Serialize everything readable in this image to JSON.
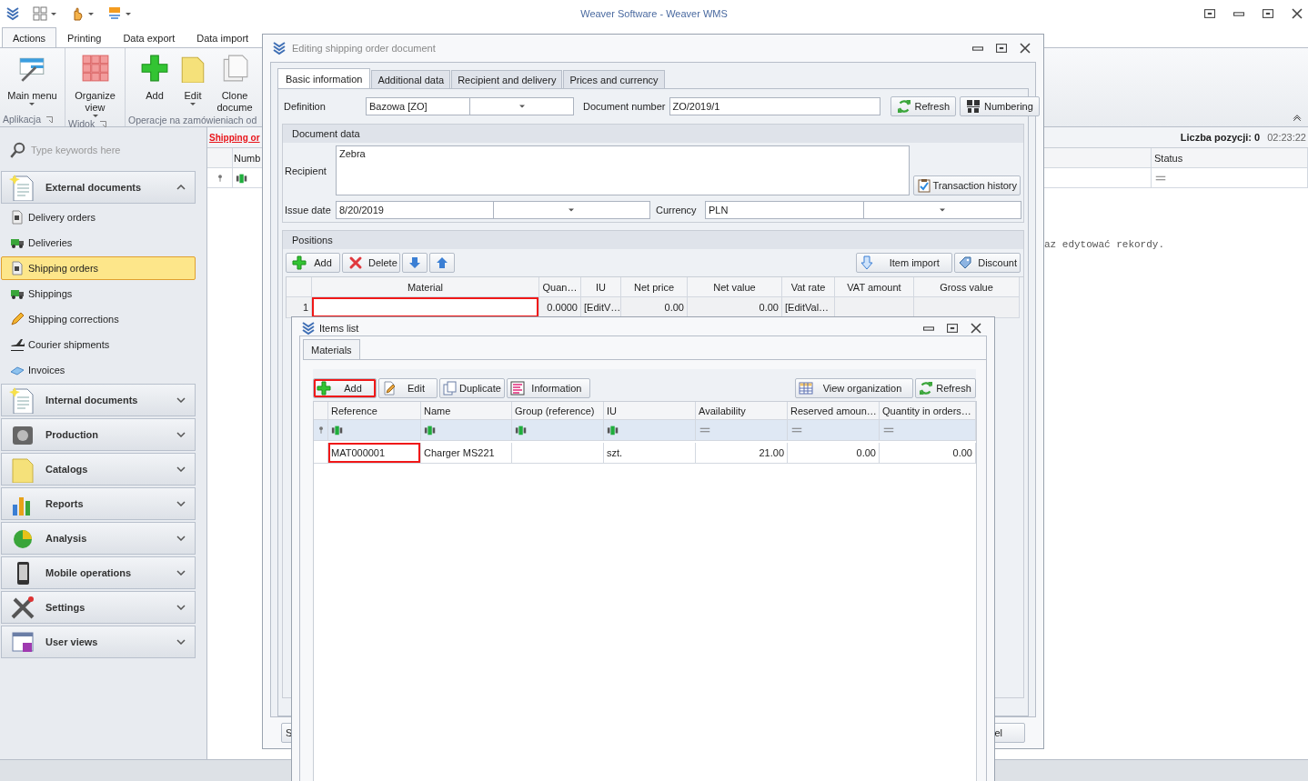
{
  "window": {
    "title": "Weaver Software - Weaver WMS"
  },
  "ribbon": {
    "tabs": [
      {
        "label": "Actions",
        "selected": true
      },
      {
        "label": "Printing",
        "selected": false
      },
      {
        "label": "Data export",
        "selected": false
      },
      {
        "label": "Data import",
        "selected": false
      }
    ],
    "groups": [
      {
        "label": "Aplikacja",
        "launcher": true,
        "items": [
          {
            "label": "Main menu",
            "dropdown": true
          }
        ]
      },
      {
        "label": "Widok",
        "launcher": true,
        "items": [
          {
            "label": "Organize view",
            "dropdown": true
          }
        ]
      },
      {
        "label": "Operacje na zamówieniach od",
        "launcher": false,
        "items": [
          {
            "label": "Add",
            "dropdown": false
          },
          {
            "label": "Edit",
            "dropdown": true
          },
          {
            "label": "Clone docume",
            "dropdown": false
          }
        ]
      }
    ]
  },
  "sidebar": {
    "search": {
      "placeholder": "Type keywords here"
    },
    "groups": [
      {
        "label": "External documents",
        "expanded": true,
        "items": [
          {
            "label": "Delivery orders",
            "selected": false
          },
          {
            "label": "Deliveries",
            "selected": false
          },
          {
            "label": "Shipping orders",
            "selected": true
          },
          {
            "label": "Shippings",
            "selected": false
          },
          {
            "label": "Shipping corrections",
            "selected": false
          },
          {
            "label": "Courier shipments",
            "selected": false
          },
          {
            "label": "Invoices",
            "selected": false
          }
        ]
      },
      {
        "label": "Internal documents",
        "expanded": false
      },
      {
        "label": "Production",
        "expanded": false
      },
      {
        "label": "Catalogs",
        "expanded": false
      },
      {
        "label": "Reports",
        "expanded": false
      },
      {
        "label": "Analysis",
        "expanded": false
      },
      {
        "label": "Mobile operations",
        "expanded": false
      },
      {
        "label": "Settings",
        "expanded": false
      },
      {
        "label": "User views",
        "expanded": false
      }
    ]
  },
  "main": {
    "title": "Shipping or",
    "count": "Liczba pozycji: 0",
    "time": "02:23:22",
    "columns": [
      "Numb",
      "Status"
    ],
    "hint": "az edytować rekordy."
  },
  "editor": {
    "title": "Editing shipping order document",
    "tabs": [
      {
        "label": "Basic information",
        "selected": true
      },
      {
        "label": "Additional data",
        "selected": false
      },
      {
        "label": "Recipient and delivery",
        "selected": false
      },
      {
        "label": "Prices and currency",
        "selected": false
      }
    ],
    "definition": {
      "label": "Definition",
      "value": "Bazowa [ZO]"
    },
    "document_number": {
      "label": "Document number",
      "value": "ZO/2019/1"
    },
    "buttons": [
      {
        "kind": "refresh",
        "label": "Refresh"
      },
      {
        "kind": "numbering",
        "label": "Numbering"
      }
    ],
    "document_data": {
      "title": "Document data",
      "recipient_label": "Recipient",
      "recipient": "Zebra",
      "history_button": "Transaction history",
      "issue_date_label": "Issue date",
      "issue_date": "8/20/2019",
      "currency_label": "Currency",
      "currency": "PLN"
    },
    "positions": {
      "title": "Positions",
      "toolbar": [
        {
          "kind": "add",
          "label": "Add"
        },
        {
          "kind": "delete",
          "label": "Delete"
        },
        {
          "kind": "down"
        },
        {
          "kind": "up"
        }
      ],
      "toolbar_right": [
        {
          "kind": "import",
          "label": "Item import"
        },
        {
          "kind": "discount",
          "label": "Discount"
        }
      ],
      "columns": [
        "Material",
        "Quan…",
        "IU",
        "Net price",
        "Net value",
        "Vat rate",
        "VAT amount",
        "Gross value"
      ],
      "rows": [
        {
          "number": "1",
          "cells": [
            {
              "highlighted": true
            },
            {
              "text": "0.0000",
              "highlighted": false
            },
            {
              "text": "[EditV…",
              "highlighted": false
            },
            {
              "text": "0.00",
              "highlighted": false
            },
            {
              "text": "0.00",
              "highlighted": false
            },
            {
              "text": "[EditVal…",
              "highlighted": false
            },
            {
              "highlighted": false
            },
            {
              "highlighted": false
            }
          ]
        }
      ]
    },
    "footer": [
      "S",
      "el"
    ]
  },
  "items_list": {
    "title": "Items list",
    "tabs": [
      {
        "label": "Materials",
        "selected": true
      }
    ],
    "toolbar": [
      {
        "kind": "add",
        "label": "Add",
        "highlighted": true
      },
      {
        "kind": "edit",
        "label": "Edit",
        "highlighted": false
      },
      {
        "kind": "duplicate",
        "label": "Duplicate",
        "highlighted": false
      },
      {
        "kind": "information",
        "label": "Information",
        "highlighted": false
      }
    ],
    "toolbar_right": [
      {
        "kind": "view",
        "label": "View organization"
      },
      {
        "kind": "refresh",
        "label": "Refresh"
      }
    ],
    "columns": [
      "Reference",
      "Name",
      "Group (reference)",
      "IU",
      "Availability",
      "Reserved amoun…",
      "Quantity in orders…"
    ],
    "filters": [
      {
        "kind": "text"
      },
      {
        "kind": "text"
      },
      {
        "kind": "text"
      },
      {
        "kind": "text"
      },
      {
        "kind": "number"
      },
      {
        "kind": "number"
      },
      {
        "kind": "number"
      }
    ],
    "rows": [
      {
        "cells": [
          {
            "text": "MAT000001",
            "highlighted": true
          },
          {
            "text": "Charger MS221",
            "highlighted": false
          },
          {
            "highlighted": false
          },
          {
            "text": "szt.",
            "highlighted": false
          },
          {
            "text": "21.00",
            "highlighted": false
          },
          {
            "text": "0.00",
            "highlighted": false
          },
          {
            "text": "0.00",
            "highlighted": false
          }
        ]
      }
    ]
  }
}
